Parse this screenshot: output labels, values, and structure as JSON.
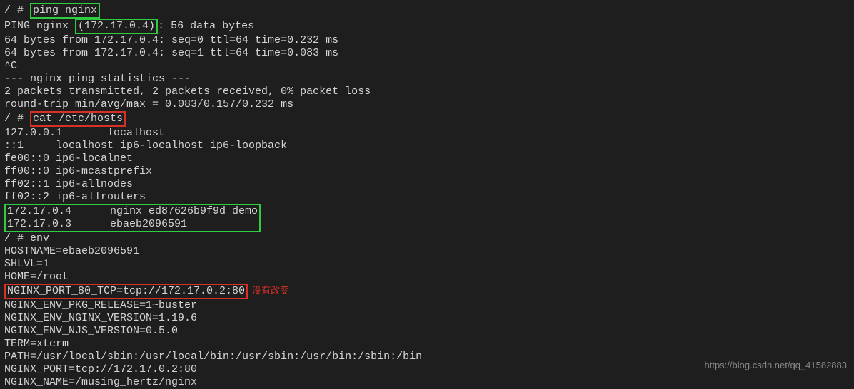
{
  "prompt1": "/ # ",
  "cmd1": "ping nginx",
  "ping_header_a": "PING nginx ",
  "ping_ip": "(172.17.0.4)",
  "ping_header_b": ": 56 data bytes",
  "ping_line1": "64 bytes from 172.17.0.4: seq=0 ttl=64 time=0.232 ms",
  "ping_line2": "64 bytes from 172.17.0.4: seq=1 ttl=64 time=0.083 ms",
  "ctrl_c": "^C",
  "stats_header": "--- nginx ping statistics ---",
  "stats_line1": "2 packets transmitted, 2 packets received, 0% packet loss",
  "stats_line2": "round-trip min/avg/max = 0.083/0.157/0.232 ms",
  "prompt2": "/ # ",
  "cmd2": "cat /etc/hosts",
  "hosts_line1": "127.0.0.1       localhost",
  "hosts_line2": "::1     localhost ip6-localhost ip6-loopback",
  "hosts_line3": "fe00::0 ip6-localnet",
  "hosts_line4": "ff00::0 ip6-mcastprefix",
  "hosts_line5": "ff02::1 ip6-allnodes",
  "hosts_line6": "ff02::2 ip6-allrouters",
  "hosts_line7": "172.17.0.4      nginx ed87626b9f9d demo",
  "hosts_line8": "172.17.0.3      ebaeb2096591          ",
  "prompt3": "/ # env",
  "env_line1": "HOSTNAME=ebaeb2096591",
  "env_line2": "SHLVL=1",
  "env_line3": "HOME=/root",
  "env_line4": "NGINX_PORT_80_TCP=tcp://172.17.0.2:80",
  "env_annotation": "没有改变",
  "env_line5": "NGINX_ENV_PKG_RELEASE=1~buster",
  "env_line6": "NGINX_ENV_NGINX_VERSION=1.19.6",
  "env_line7": "NGINX_ENV_NJS_VERSION=0.5.0",
  "env_line8": "TERM=xterm",
  "env_line9": "PATH=/usr/local/sbin:/usr/local/bin:/usr/sbin:/usr/bin:/sbin:/bin",
  "env_line10": "NGINX_PORT=tcp://172.17.0.2:80",
  "env_line11": "NGINX_NAME=/musing_hertz/nginx",
  "watermark": "https://blog.csdn.net/qq_41582883"
}
